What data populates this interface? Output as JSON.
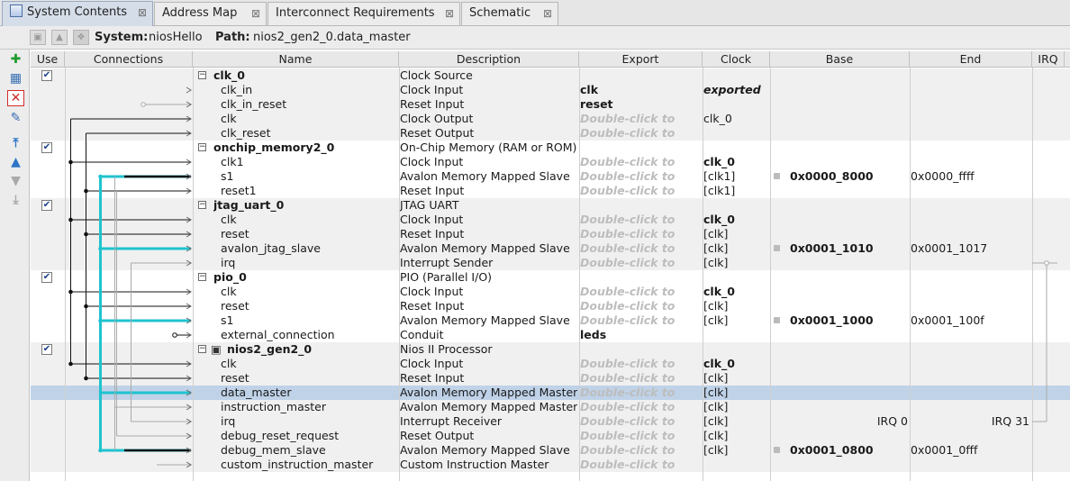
{
  "tabs": [
    {
      "label": "System Contents",
      "active": true
    },
    {
      "label": "Address Map",
      "active": false
    },
    {
      "label": "Interconnect Requirements",
      "active": false
    },
    {
      "label": "Schematic",
      "active": false
    }
  ],
  "header": {
    "system_label": "System:",
    "system_value": "niosHello",
    "path_label": "Path:",
    "path_value": "nios2_gen2_0.data_master"
  },
  "columns": [
    "Use",
    "Connections",
    "Name",
    "Description",
    "Export",
    "Clock",
    "Base",
    "End",
    "IRQ"
  ],
  "rows": [
    {
      "type": "comp",
      "name": "clk_0",
      "desc": "Clock Source",
      "export": "",
      "clock": "",
      "base": "",
      "end": "",
      "irq": "",
      "use": true
    },
    {
      "type": "iface",
      "name": "clk_in",
      "desc": "Clock Input",
      "export": "clk",
      "clock": "exported",
      "clockStyle": "ital",
      "base": "",
      "end": ""
    },
    {
      "type": "iface",
      "name": "clk_in_reset",
      "desc": "Reset Input",
      "export": "reset",
      "clock": "",
      "base": "",
      "end": ""
    },
    {
      "type": "iface",
      "name": "clk",
      "desc": "Clock Output",
      "export": "Double-click to",
      "hint": true,
      "clock": "clk_0",
      "base": "",
      "end": ""
    },
    {
      "type": "iface",
      "name": "clk_reset",
      "desc": "Reset Output",
      "export": "Double-click to",
      "hint": true,
      "clock": "",
      "base": "",
      "end": ""
    },
    {
      "type": "comp",
      "name": "onchip_memory2_0",
      "desc": "On-Chip Memory (RAM or ROM)",
      "export": "",
      "clock": "",
      "base": "",
      "end": "",
      "use": true
    },
    {
      "type": "iface",
      "name": "clk1",
      "desc": "Clock Input",
      "export": "Double-click to",
      "hint": true,
      "clock": "clk_0",
      "clockStyle": "bold",
      "base": "",
      "end": ""
    },
    {
      "type": "iface",
      "name": "s1",
      "desc": "Avalon Memory Mapped Slave",
      "export": "Double-click to",
      "hint": true,
      "clock": "[clk1]",
      "base": "0x0000_8000",
      "end": "0x0000_ffff",
      "lock": true
    },
    {
      "type": "iface",
      "name": "reset1",
      "desc": "Reset Input",
      "export": "Double-click to",
      "hint": true,
      "clock": "[clk1]",
      "base": "",
      "end": ""
    },
    {
      "type": "comp",
      "name": "jtag_uart_0",
      "desc": "JTAG UART",
      "export": "",
      "clock": "",
      "base": "",
      "end": "",
      "use": true
    },
    {
      "type": "iface",
      "name": "clk",
      "desc": "Clock Input",
      "export": "Double-click to",
      "hint": true,
      "clock": "clk_0",
      "clockStyle": "bold",
      "base": "",
      "end": ""
    },
    {
      "type": "iface",
      "name": "reset",
      "desc": "Reset Input",
      "export": "Double-click to",
      "hint": true,
      "clock": "[clk]",
      "base": "",
      "end": ""
    },
    {
      "type": "iface",
      "name": "avalon_jtag_slave",
      "desc": "Avalon Memory Mapped Slave",
      "export": "Double-click to",
      "hint": true,
      "clock": "[clk]",
      "base": "0x0001_1010",
      "end": "0x0001_1017",
      "lock": true
    },
    {
      "type": "iface",
      "name": "irq",
      "desc": "Interrupt Sender",
      "export": "Double-click to",
      "hint": true,
      "clock": "[clk]",
      "base": "",
      "end": ""
    },
    {
      "type": "comp",
      "name": "pio_0",
      "desc": "PIO (Parallel I/O)",
      "export": "",
      "clock": "",
      "base": "",
      "end": "",
      "use": true
    },
    {
      "type": "iface",
      "name": "clk",
      "desc": "Clock Input",
      "export": "Double-click to",
      "hint": true,
      "clock": "clk_0",
      "clockStyle": "bold",
      "base": "",
      "end": ""
    },
    {
      "type": "iface",
      "name": "reset",
      "desc": "Reset Input",
      "export": "Double-click to",
      "hint": true,
      "clock": "[clk]",
      "base": "",
      "end": ""
    },
    {
      "type": "iface",
      "name": "s1",
      "desc": "Avalon Memory Mapped Slave",
      "export": "Double-click to",
      "hint": true,
      "clock": "[clk]",
      "base": "0x0001_1000",
      "end": "0x0001_100f",
      "lock": true
    },
    {
      "type": "iface",
      "name": "external_connection",
      "desc": "Conduit",
      "export": "leds",
      "clock": "",
      "base": "",
      "end": ""
    },
    {
      "type": "comp",
      "name": "nios2_gen2_0",
      "desc": "Nios II Processor",
      "export": "",
      "clock": "",
      "base": "",
      "end": "",
      "use": true,
      "cpu": true
    },
    {
      "type": "iface",
      "name": "clk",
      "desc": "Clock Input",
      "export": "Double-click to",
      "hint": true,
      "clock": "clk_0",
      "clockStyle": "bold",
      "base": "",
      "end": ""
    },
    {
      "type": "iface",
      "name": "reset",
      "desc": "Reset Input",
      "export": "Double-click to",
      "hint": true,
      "clock": "[clk]",
      "base": "",
      "end": ""
    },
    {
      "type": "iface",
      "name": "data_master",
      "desc": "Avalon Memory Mapped Master",
      "export": "Double-click to",
      "hint": true,
      "clock": "[clk]",
      "base": "",
      "end": "",
      "selected": true
    },
    {
      "type": "iface",
      "name": "instruction_master",
      "desc": "Avalon Memory Mapped Master",
      "export": "Double-click to",
      "hint": true,
      "clock": "[clk]",
      "base": "",
      "end": ""
    },
    {
      "type": "iface",
      "name": "irq",
      "desc": "Interrupt Receiver",
      "export": "Double-click to",
      "hint": true,
      "clock": "[clk]",
      "base": "IRQ 0",
      "end": "IRQ 31",
      "irqRange": true
    },
    {
      "type": "iface",
      "name": "debug_reset_request",
      "desc": "Reset Output",
      "export": "Double-click to",
      "hint": true,
      "clock": "[clk]",
      "base": "",
      "end": ""
    },
    {
      "type": "iface",
      "name": "debug_mem_slave",
      "desc": "Avalon Memory Mapped Slave",
      "export": "Double-click to",
      "hint": true,
      "clock": "[clk]",
      "base": "0x0001_0800",
      "end": "0x0001_0fff",
      "lock": true
    },
    {
      "type": "iface",
      "name": "custom_instruction_master",
      "desc": "Custom Instruction Master",
      "export": "Double-click to",
      "hint": true,
      "clock": "",
      "base": "",
      "end": ""
    }
  ],
  "colors": {
    "selection": "#bfd2e8",
    "avalon": "#1fc3cf",
    "hint": "#bdbdbd"
  }
}
